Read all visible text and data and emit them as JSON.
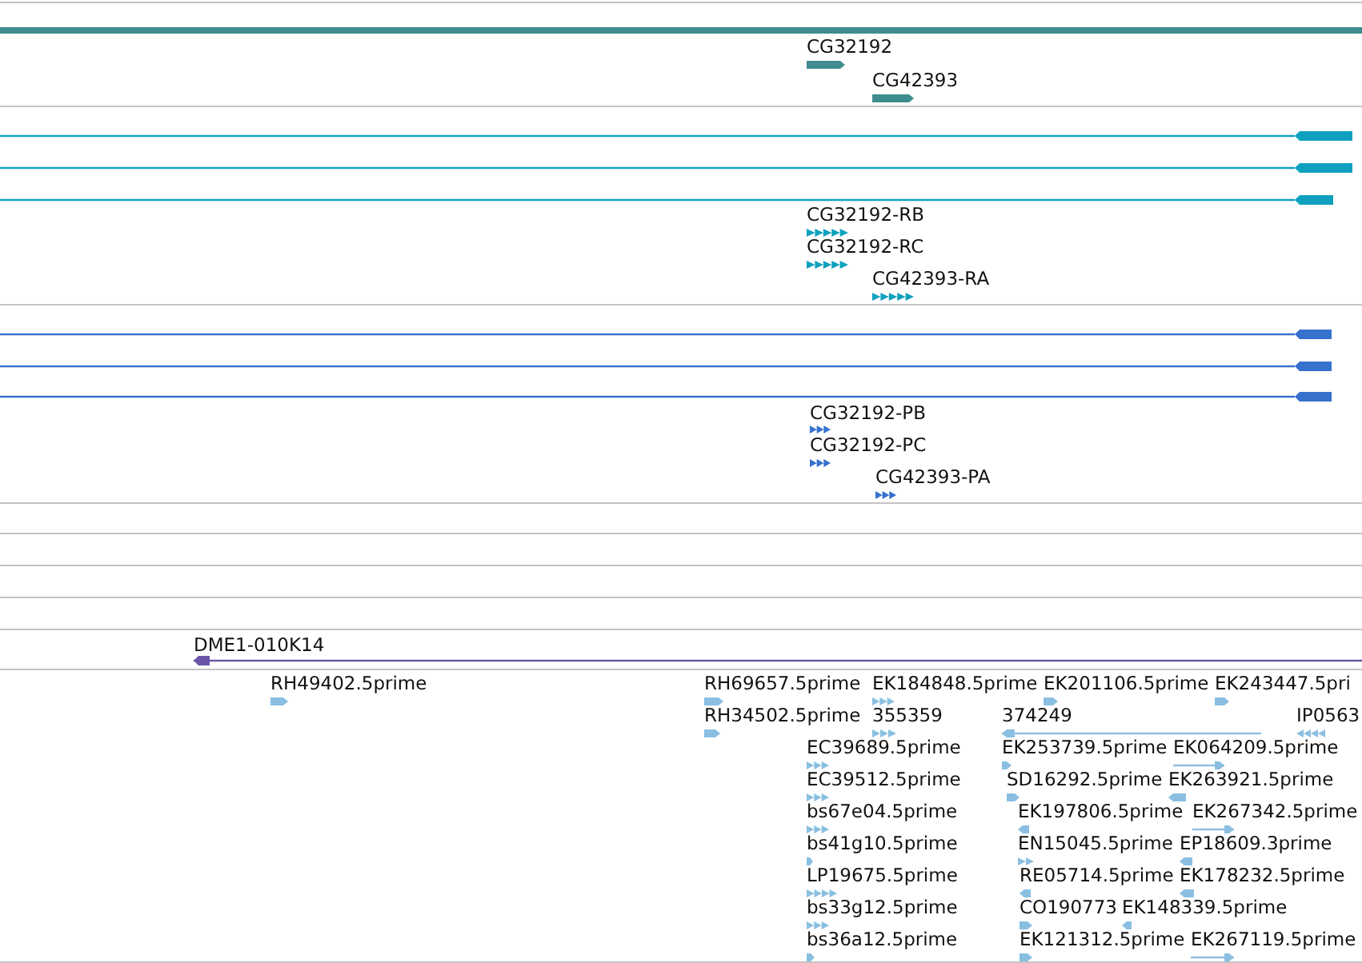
{
  "tracks": [
    {
      "kind": "genes",
      "features": [
        {
          "kind": "bar"
        },
        {
          "kind": "arrow",
          "label": "CG32192",
          "reverse": false
        },
        {
          "kind": "arrow",
          "label": "CG42393",
          "reverse": false
        }
      ]
    },
    {
      "kind": "transcripts",
      "features": [
        {
          "kind": "line",
          "reverse": true
        },
        {
          "kind": "line",
          "reverse": true
        },
        {
          "kind": "line",
          "reverse": true
        },
        {
          "kind": "chevrons",
          "label": "CG32192-RB",
          "reverse": false
        },
        {
          "kind": "chevrons",
          "label": "CG32192-RC",
          "reverse": false
        },
        {
          "kind": "chevrons",
          "label": "CG42393-RA",
          "reverse": false
        }
      ]
    },
    {
      "kind": "proteins",
      "features": [
        {
          "kind": "line",
          "reverse": true
        },
        {
          "kind": "line",
          "reverse": true
        },
        {
          "kind": "line",
          "reverse": true
        },
        {
          "kind": "chevrons",
          "label": "CG32192-PB",
          "reverse": false
        },
        {
          "kind": "chevrons",
          "label": "CG32192-PC",
          "reverse": false
        },
        {
          "kind": "chevrons",
          "label": "CG42393-PA",
          "reverse": false
        }
      ]
    },
    {
      "kind": "empty"
    },
    {
      "kind": "empty"
    },
    {
      "kind": "empty"
    },
    {
      "kind": "empty"
    },
    {
      "kind": "clones",
      "features": [
        {
          "kind": "line",
          "label": "DME1-010K14",
          "reverse": true
        }
      ]
    },
    {
      "kind": "ests",
      "features": [
        {
          "kind": "arrow",
          "label": "RH49402.5prime",
          "reverse": false
        },
        {
          "kind": "arrow",
          "label": "RH69657.5prime",
          "reverse": false
        },
        {
          "kind": "chevrons",
          "label": "EK184848.5prime",
          "reverse": false
        },
        {
          "kind": "arrow",
          "label": "EK201106.5prime",
          "reverse": false
        },
        {
          "kind": "arrow",
          "label": "EK243447.5pri",
          "reverse": false
        },
        {
          "kind": "arrow",
          "label": "RH34502.5prime",
          "reverse": false
        },
        {
          "kind": "chevrons",
          "label": "355359",
          "reverse": false
        },
        {
          "kind": "line",
          "label": "374249",
          "reverse": true
        },
        {
          "kind": "chevrons",
          "label": "IP0563",
          "reverse": true
        },
        {
          "kind": "chevrons",
          "label": "EC39689.5prime",
          "reverse": false
        },
        {
          "kind": "arrow",
          "label": "EK253739.5prime",
          "reverse": false
        },
        {
          "kind": "line",
          "label": "EK064209.5prime",
          "reverse": false
        },
        {
          "kind": "chevrons",
          "label": "EC39512.5prime",
          "reverse": false
        },
        {
          "kind": "arrow",
          "label": "SD16292.5prime",
          "reverse": false
        },
        {
          "kind": "arrow",
          "label": "EK263921.5prime",
          "reverse": true
        },
        {
          "kind": "chevrons",
          "label": "bs67e04.5prime",
          "reverse": false
        },
        {
          "kind": "arrow",
          "label": "EK197806.5prime",
          "reverse": true
        },
        {
          "kind": "line",
          "label": "EK267342.5prime",
          "reverse": false
        },
        {
          "kind": "arrow",
          "label": "bs41g10.5prime",
          "reverse": false
        },
        {
          "kind": "chevrons",
          "label": "EN15045.5prime",
          "reverse": false
        },
        {
          "kind": "arrow",
          "label": "EP18609.3prime",
          "reverse": true
        },
        {
          "kind": "chevrons",
          "label": "LP19675.5prime",
          "reverse": false
        },
        {
          "kind": "arrow",
          "label": "RE05714.5prime",
          "reverse": true
        },
        {
          "kind": "arrow",
          "label": "EK178232.5prime",
          "reverse": true
        },
        {
          "kind": "chevrons",
          "label": "bs33g12.5prime",
          "reverse": false
        },
        {
          "kind": "arrow",
          "label": "CO190773",
          "reverse": false
        },
        {
          "kind": "arrow",
          "label": "EK148339.5prime",
          "reverse": true
        },
        {
          "kind": "arrow",
          "label": "bs36a12.5prime",
          "reverse": false
        },
        {
          "kind": "arrow",
          "label": "EK121312.5prime",
          "reverse": false
        },
        {
          "kind": "line",
          "label": "EK267119.5prime",
          "reverse": false
        }
      ]
    }
  ]
}
